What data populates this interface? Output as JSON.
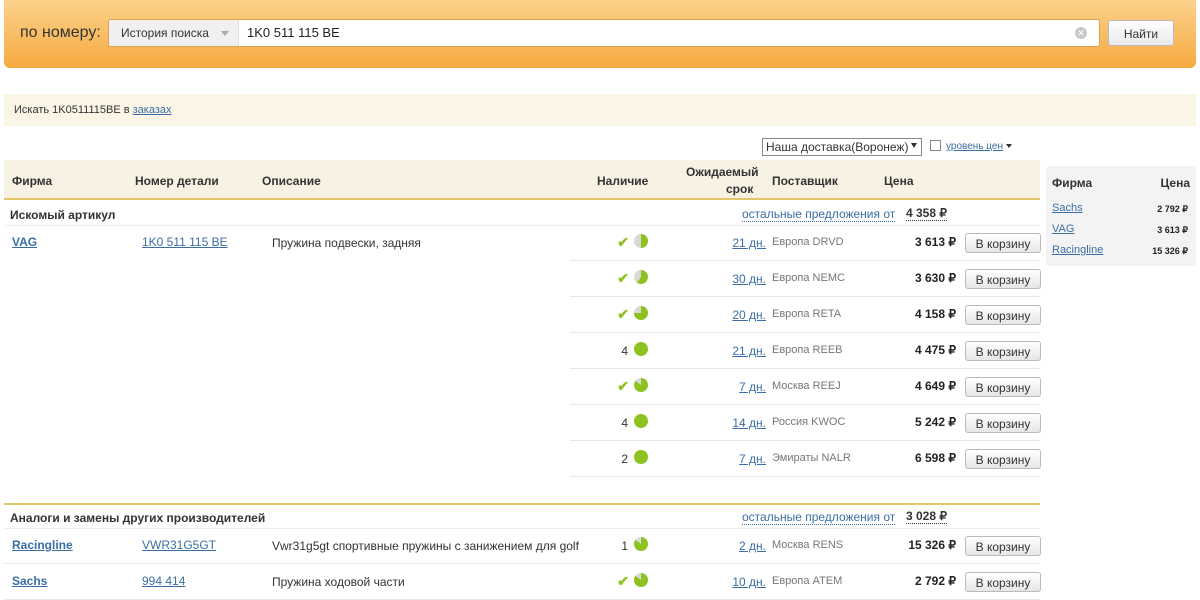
{
  "search": {
    "label": "по номеру:",
    "history_label": "История поиска",
    "query": "1K0 511 115 BE",
    "find_button": "Найти"
  },
  "orders": {
    "prefix": "Искать 1K0511115BE в ",
    "link": "заказах"
  },
  "options": {
    "delivery": "Наша доставка(Воронеж)",
    "price_level": "уровень цен"
  },
  "columns": {
    "brand": "Фирма",
    "part_number": "Номер детали",
    "description": "Описание",
    "availability": "Наличие",
    "expected_line1": "Ожидаемый",
    "expected_line2": "срок",
    "supplier": "Поставщик",
    "price": "Цена"
  },
  "sections": {
    "searched": {
      "title": "Искомый артикул",
      "others_link": "остальные предложения от",
      "min_price": "4 358 ₽",
      "brand": "VAG",
      "part_number": "1K0 511 115 BE",
      "description": "Пружина подвески, задняя"
    },
    "analogs": {
      "title": "Аналоги и замены других производителей",
      "others_link": "остальные предложения от",
      "min_price": "3 028 ₽"
    }
  },
  "offers": [
    {
      "avail_qty": "",
      "check": true,
      "pie": 0.5,
      "days": "21 дн.",
      "supplier": "Европа DRVD",
      "price": "3 613 ₽",
      "cart": "В корзину"
    },
    {
      "avail_qty": "",
      "check": true,
      "pie": 0.6,
      "days": "30 дн.",
      "supplier": "Европа NEMC",
      "price": "3 630 ₽",
      "cart": "В корзину"
    },
    {
      "avail_qty": "",
      "check": true,
      "pie": 0.75,
      "days": "20 дн.",
      "supplier": "Европа RETA",
      "price": "4 158 ₽",
      "cart": "В корзину"
    },
    {
      "avail_qty": "4",
      "check": false,
      "pie": 1.0,
      "days": "21 дн.",
      "supplier": "Европа REEB",
      "price": "4 475 ₽",
      "cart": "В корзину"
    },
    {
      "avail_qty": "",
      "check": true,
      "pie": 0.85,
      "days": "7 дн.",
      "supplier": "Москва REEJ",
      "price": "4 649 ₽",
      "cart": "В корзину"
    },
    {
      "avail_qty": "4",
      "check": false,
      "pie": 1.0,
      "days": "14 дн.",
      "supplier": "Россия KWOC",
      "price": "5 242 ₽",
      "cart": "В корзину"
    },
    {
      "avail_qty": "2",
      "check": false,
      "pie": 1.0,
      "days": "7 дн.",
      "supplier": "Эмираты NALR",
      "price": "6 598 ₽",
      "cart": "В корзину"
    }
  ],
  "analog_offers": [
    {
      "brand": "Racingline",
      "part_number": "VWR31G5GT",
      "description": "Vwr31g5gt спортивные пружины с занижением для golf",
      "avail_qty": "1",
      "check": false,
      "pie": 0.85,
      "days": "2 дн.",
      "supplier": "Москва RENS",
      "price": "15 326 ₽",
      "cart": "В корзину"
    },
    {
      "brand": "Sachs",
      "part_number": "994 414",
      "description": "Пружина ходовой части",
      "avail_qty": "",
      "check": true,
      "pie": 0.85,
      "days": "10 дн.",
      "supplier": "Европа ATEM",
      "price": "2 792 ₽",
      "cart": "В корзину"
    }
  ],
  "side_panel": {
    "brand_header": "Фирма",
    "price_header": "Цена",
    "items": [
      {
        "brand": "Sachs",
        "price": "2 792 ₽"
      },
      {
        "brand": "VAG",
        "price": "3 613 ₽"
      },
      {
        "brand": "Racingline",
        "price": "15 326 ₽"
      }
    ]
  },
  "colors": {
    "accent_green": "#8dc21f",
    "pie_empty": "#d8d8d8",
    "link": "#3a6ea5",
    "header_orange": "#f6a93f"
  }
}
